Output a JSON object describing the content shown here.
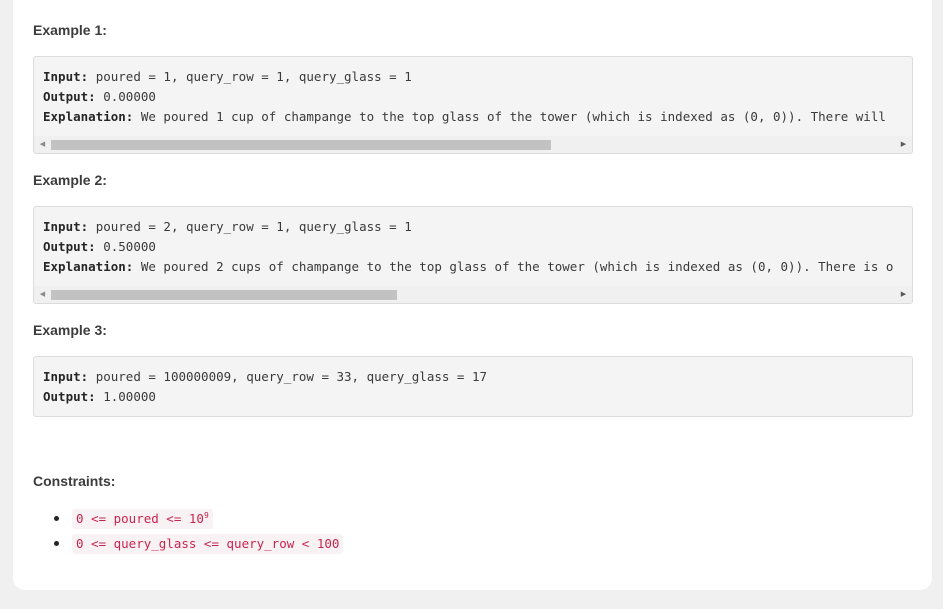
{
  "examples": [
    {
      "heading": "Example 1:",
      "input_label": "Input:",
      "input_value": "poured = 1, query_row = 1, query_glass = 1",
      "output_label": "Output:",
      "output_value": "0.00000",
      "explanation_label": "Explanation:",
      "explanation_value": "We poured 1 cup of champange to the top glass of the tower (which is indexed as (0, 0)). There will"
    },
    {
      "heading": "Example 2:",
      "input_label": "Input:",
      "input_value": "poured = 2, query_row = 1, query_glass = 1",
      "output_label": "Output:",
      "output_value": "0.50000",
      "explanation_label": "Explanation:",
      "explanation_value": "We poured 2 cups of champange to the top glass of the tower (which is indexed as (0, 0)). There is o"
    },
    {
      "heading": "Example 3:",
      "input_label": "Input:",
      "input_value": "poured = 100000009, query_row = 33, query_glass = 17",
      "output_label": "Output:",
      "output_value": "1.00000"
    }
  ],
  "constraints": {
    "heading": "Constraints:",
    "items": [
      {
        "text": "0 <= poured <= 10",
        "sup": "9"
      },
      {
        "text": "0 <= query_glass <= query_row < 100"
      }
    ]
  },
  "icons": {
    "scroll_left": "scroll-left-arrow-icon",
    "scroll_right": "scroll-right-arrow-icon"
  }
}
